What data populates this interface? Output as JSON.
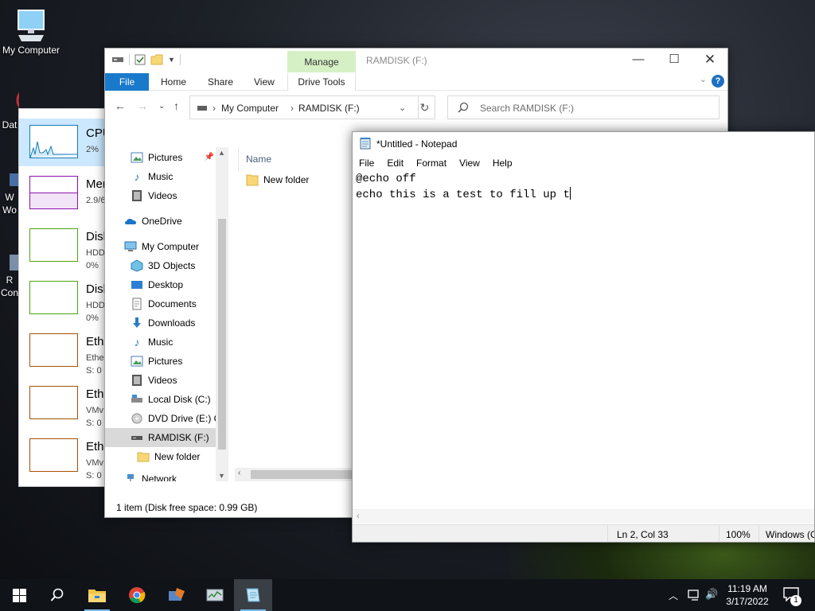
{
  "desktop": {
    "icons": [
      {
        "label": "My Computer"
      },
      {
        "label": "Dat"
      },
      {
        "label": "W"
      },
      {
        "label": "Wo"
      },
      {
        "label": "R"
      },
      {
        "label": "Con"
      }
    ]
  },
  "task_manager": {
    "items": [
      {
        "title": "CPU",
        "sub": "2%",
        "color": "#117dbb"
      },
      {
        "title": "Mem",
        "sub": "2.9/6",
        "color": "#8b12ae"
      },
      {
        "title": "Disk",
        "sub": "HDD\n0%",
        "color": "#4da60c"
      },
      {
        "title": "Disk",
        "sub": "HDD\n0%",
        "color": "#4da60c"
      },
      {
        "title": "Ethe",
        "sub": "Ethe\nS: 0",
        "color": "#a74f01"
      },
      {
        "title": "Ethe",
        "sub": "VMv\nS: 0",
        "color": "#a74f01"
      },
      {
        "title": "Ethe",
        "sub": "VMv\nS: 0",
        "color": "#a74f01"
      }
    ]
  },
  "explorer": {
    "title": "RAMDISK (F:)",
    "manage_tab": "Manage",
    "ribbon_tabs": [
      "File",
      "Home",
      "Share",
      "View",
      "Drive Tools"
    ],
    "address": {
      "root": "My Computer",
      "current": "RAMDISK (F:)"
    },
    "search_placeholder": "Search RAMDISK (F:)",
    "nav_items": [
      {
        "label": "Pictures",
        "icon": "pictures-icon"
      },
      {
        "label": "Music",
        "icon": "music-icon"
      },
      {
        "label": "Videos",
        "icon": "videos-icon"
      },
      {
        "label": "OneDrive",
        "icon": "onedrive-icon"
      },
      {
        "label": "My Computer",
        "icon": "computer-icon"
      },
      {
        "label": "3D Objects",
        "icon": "3d-objects-icon"
      },
      {
        "label": "Desktop",
        "icon": "desktop-icon"
      },
      {
        "label": "Documents",
        "icon": "documents-icon"
      },
      {
        "label": "Downloads",
        "icon": "downloads-icon"
      },
      {
        "label": "Music",
        "icon": "music-icon"
      },
      {
        "label": "Pictures",
        "icon": "pictures-icon"
      },
      {
        "label": "Videos",
        "icon": "videos-icon"
      },
      {
        "label": "Local Disk (C:)",
        "icon": "local-disk-icon"
      },
      {
        "label": "DVD Drive (E:) CI",
        "icon": "dvd-drive-icon"
      },
      {
        "label": "RAMDISK (F:)",
        "icon": "ramdisk-icon"
      },
      {
        "label": "New folder",
        "icon": "folder-icon"
      },
      {
        "label": "Network",
        "icon": "network-icon"
      }
    ],
    "column_header": "Name",
    "files": [
      {
        "name": "New folder"
      }
    ],
    "status": "1 item (Disk free space: 0.99 GB)"
  },
  "notepad": {
    "title": "*Untitled - Notepad",
    "menu": [
      "File",
      "Edit",
      "Format",
      "View",
      "Help"
    ],
    "lines": [
      "@echo off",
      "echo this is a test to fill up t"
    ],
    "status": {
      "position": "Ln 2, Col 33",
      "zoom": "100%",
      "encoding": "Windows (C"
    }
  },
  "taskbar": {
    "time": "11:19 AM",
    "date": "3/17/2022",
    "notification_count": "1"
  },
  "colors": {
    "accent": "#1979ca",
    "selection": "#cce8ff",
    "taskbar": "#101318"
  }
}
